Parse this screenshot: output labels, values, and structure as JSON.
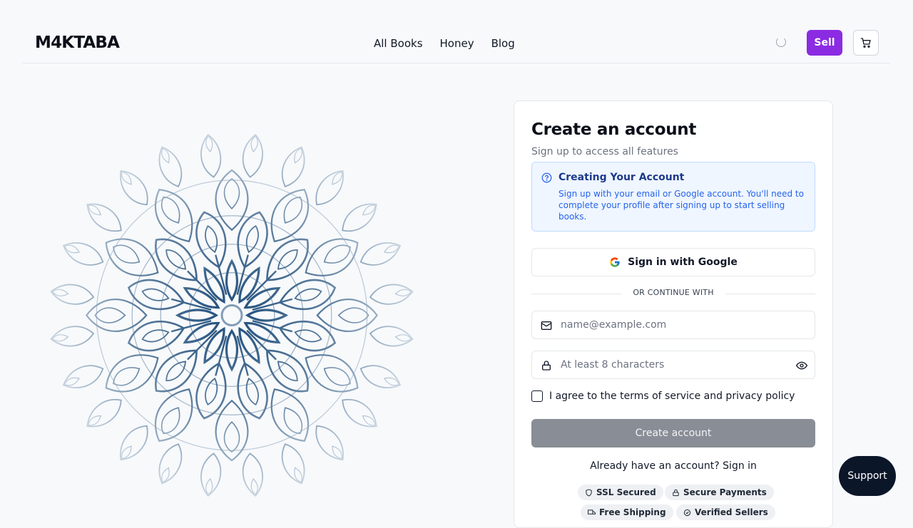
{
  "header": {
    "logo": "M4KTABA",
    "nav": [
      "All Books",
      "Honey",
      "Blog"
    ],
    "sell_label": "Sell",
    "cart_icon": "cart-icon"
  },
  "card": {
    "title": "Create an account",
    "subtitle": "Sign up to access all features",
    "info": {
      "title": "Creating Your Account",
      "text": "Sign up with your email or Google account. You'll need to complete your profile after signing up to start selling books."
    },
    "google_label": "Sign in with Google",
    "divider": "OR CONTINUE WITH",
    "email": {
      "value": "",
      "placeholder": "name@example.com"
    },
    "password": {
      "value": "",
      "placeholder": "At least 8 characters"
    },
    "agree_label": "I agree to the terms of service and privacy policy",
    "agree_checked": false,
    "create_label": "Create account",
    "signin_text": "Already have an account? Sign in",
    "badges": [
      "SSL Secured",
      "Secure Payments",
      "Free Shipping",
      "Verified Sellers"
    ]
  },
  "support_label": "Support",
  "colors": {
    "accent": "#8b2be2",
    "info_bg": "#eff6ff",
    "info_text": "#2563eb",
    "disabled_button": "#898d95",
    "support_bg": "#0b1629"
  }
}
